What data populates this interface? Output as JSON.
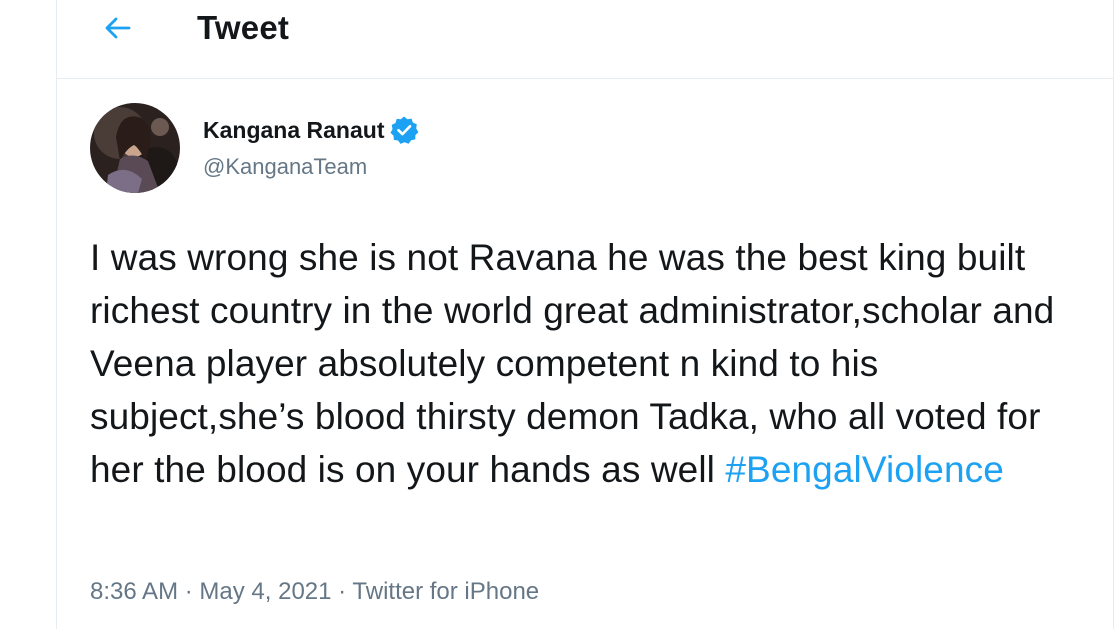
{
  "header": {
    "title": "Tweet",
    "back_icon": "arrow-left-icon"
  },
  "tweet": {
    "author": {
      "name": "Kangana Ranaut",
      "handle": "@KanganaTeam",
      "verified": true,
      "avatar": "profile-photo"
    },
    "text": "I was wrong she is not Ravana he was the best king built richest country in the world great administrator,scholar and Veena player absolutely competent n kind to his subject,she’s blood thirsty demon Tadka, who all voted for her the blood is on your hands as well",
    "hashtag": "#BengalViolence",
    "time": "8:36 AM",
    "separator": "·",
    "date": "May 4, 2021",
    "source": "Twitter for iPhone"
  },
  "colors": {
    "accent": "#1da1f2",
    "text": "#14171a",
    "secondary": "#657786",
    "border": "#e6ecf0"
  }
}
